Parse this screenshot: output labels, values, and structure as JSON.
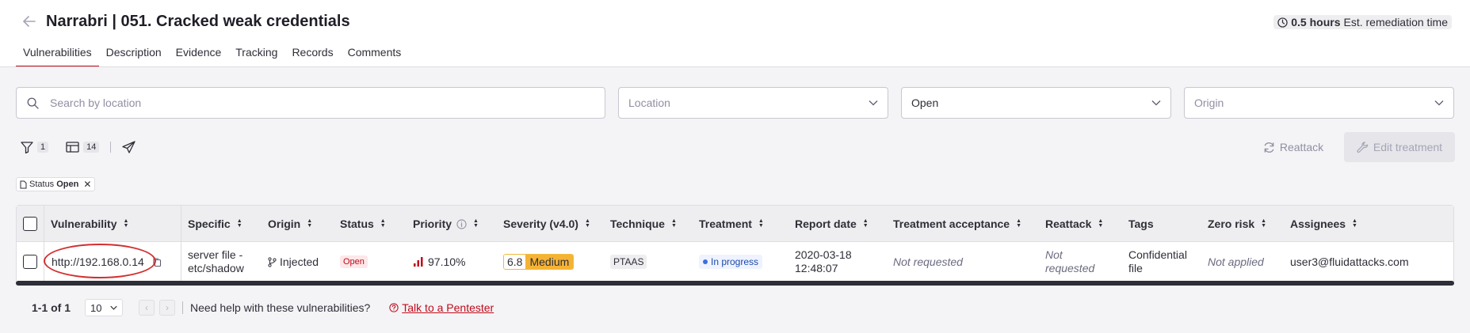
{
  "header": {
    "title": "Narrabri | 051. Cracked weak credentials",
    "remediation_hours": "0.5 hours",
    "remediation_label": "Est. remediation time"
  },
  "tabs": [
    {
      "label": "Vulnerabilities",
      "active": true
    },
    {
      "label": "Description"
    },
    {
      "label": "Evidence"
    },
    {
      "label": "Tracking"
    },
    {
      "label": "Records"
    },
    {
      "label": "Comments"
    }
  ],
  "filters": {
    "search_placeholder": "Search by location",
    "location_placeholder": "Location",
    "status_value": "Open",
    "origin_placeholder": "Origin"
  },
  "toolbar": {
    "filter_count": "1",
    "columns_count": "14",
    "reattack_label": "Reattack",
    "edit_treatment_label": "Edit treatment"
  },
  "active_filter": {
    "label": "Status",
    "value": "Open"
  },
  "table": {
    "columns": [
      "Vulnerability",
      "Specific",
      "Origin",
      "Status",
      "Priority",
      "Severity (v4.0)",
      "Technique",
      "Treatment",
      "Report date",
      "Treatment acceptance",
      "Reattack",
      "Tags",
      "Zero risk",
      "Assignees"
    ],
    "rows": [
      {
        "vulnerability": "http://192.168.0.14",
        "specific_1": "server file -",
        "specific_2": "etc/shadow",
        "origin": "Injected",
        "status": "Open",
        "priority": "97.10%",
        "severity_score": "6.8",
        "severity_label": "Medium",
        "technique": "PTAAS",
        "treatment": "In progress",
        "report_date_1": "2020-03-18",
        "report_date_2": "12:48:07",
        "treatment_acceptance": "Not requested",
        "reattack_1": "Not",
        "reattack_2": "requested",
        "tags_1": "Confidential",
        "tags_2": "file",
        "zero_risk": "Not applied",
        "assignees": "user3@fluidattacks.com"
      }
    ]
  },
  "pagination": {
    "range": "1-1 of 1",
    "per_page": "10",
    "help_text": "Need help with these vulnerabilities?",
    "help_link": "Talk to a Pentester"
  },
  "colors": {
    "accent": "#bf0b1a",
    "severity_medium": "#f5b335"
  }
}
